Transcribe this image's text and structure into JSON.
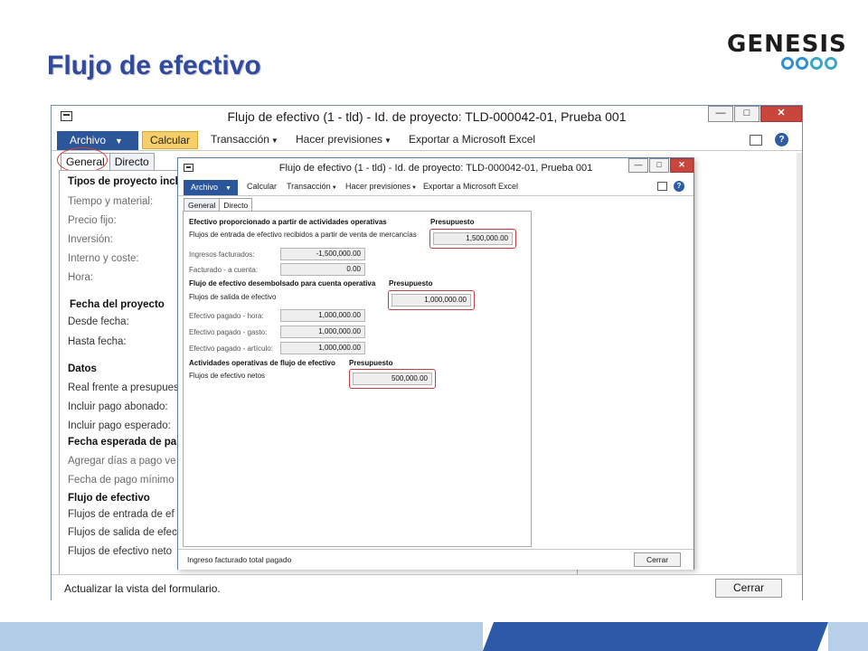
{
  "slide": {
    "title": "Flujo de efectivo",
    "logo_text": "GENESIS"
  },
  "main_window": {
    "title": "Flujo de efectivo (1 - tld) - Id. de proyecto: TLD-000042-01, Prueba 001",
    "menu": {
      "archivo": "Archivo",
      "calcular": "Calcular",
      "transaccion": "Transacción",
      "hacer_previsiones": "Hacer previsiones",
      "exportar": "Exportar a Microsoft Excel"
    },
    "tabs": [
      "General",
      "Directo"
    ],
    "fields": {
      "tipos_proyecto": "Tipos de proyecto incl",
      "tiempo_material": "Tiempo y material:",
      "precio_fijo": "Precio fijo:",
      "inversion": "Inversión:",
      "interno_coste": "Interno y coste:",
      "hora": "Hora:",
      "fecha_proyecto": "Fecha del proyecto",
      "desde_fecha": "Desde fecha:",
      "hasta_fecha": "Hasta fecha:",
      "datos": "Datos",
      "real_frente": "Real frente a presupues",
      "incluir_abonado": "Incluir pago abonado:",
      "incluir_esperado": "Incluir pago esperado:",
      "fecha_esperada": "Fecha esperada de pa",
      "agregar_dias": "Agregar días a pago ve",
      "fecha_pago_minimo": "Fecha de pago mínimo",
      "flujo_efectivo": "Flujo de efectivo",
      "flujos_entrada": "Flujos de entrada de ef",
      "flujos_salida": "Flujos de salida de efec",
      "flujos_netos": "Flujos de efectivo neto"
    },
    "status": "Actualizar la vista del formulario.",
    "close_button": "Cerrar"
  },
  "dialog": {
    "title": "Flujo de efectivo (1 - tld) - Id. de proyecto: TLD-000042-01, Prueba 001",
    "menu": {
      "archivo": "Archivo",
      "calcular": "Calcular",
      "transaccion": "Transacción",
      "hacer_previsiones": "Hacer previsiones",
      "exportar": "Exportar a Microsoft Excel"
    },
    "tabs": [
      "General",
      "Directo"
    ],
    "sections": {
      "s1_title": "Efectivo proporcionado a partir de actividades operativas",
      "s1_budget_label": "Presupuesto",
      "s1_inflow_label": "Flujos de entrada de efectivo recibidos a partir de venta de mercancías",
      "s1_inflow_value": "1,500,000.00",
      "ingresos_facturados_label": "Ingresos facturados:",
      "ingresos_facturados_value": "-1,500,000.00",
      "facturado_cuenta_label": "Facturado - a cuenta:",
      "facturado_cuenta_value": "0.00",
      "s2_title": "Flujo de efectivo desembolsado para cuenta operativa",
      "s2_budget_label": "Presupuesto",
      "s2_outflow_label": "Flujos de salida de efectivo",
      "s2_outflow_value": "1,000,000.00",
      "pagado_hora_label": "Efectivo pagado - hora:",
      "pagado_hora_value": "1,000,000.00",
      "pagado_gasto_label": "Efectivo pagado - gasto:",
      "pagado_gasto_value": "1,000,000.00",
      "pagado_articulo_label": "Efectivo pagado - artículo:",
      "pagado_articulo_value": "1,000,000.00",
      "s3_title": "Actividades operativas de flujo de efectivo",
      "s3_budget_label": "Presupuesto",
      "s3_net_label": "Flujos de efectivo netos",
      "s3_net_value": "500,000.00"
    },
    "status": "Ingreso facturado total pagado",
    "close_button": "Cerrar"
  },
  "colors": {
    "title_blue": "#2f4a9e",
    "archivo_blue": "#2b579a",
    "calcular_highlight": "#f6cf6a",
    "highlight_red": "#c93c3c",
    "logo_ring": "#2f8fd1",
    "footer_dark": "#2c5aa8",
    "footer_light": "#b8cfe9"
  }
}
